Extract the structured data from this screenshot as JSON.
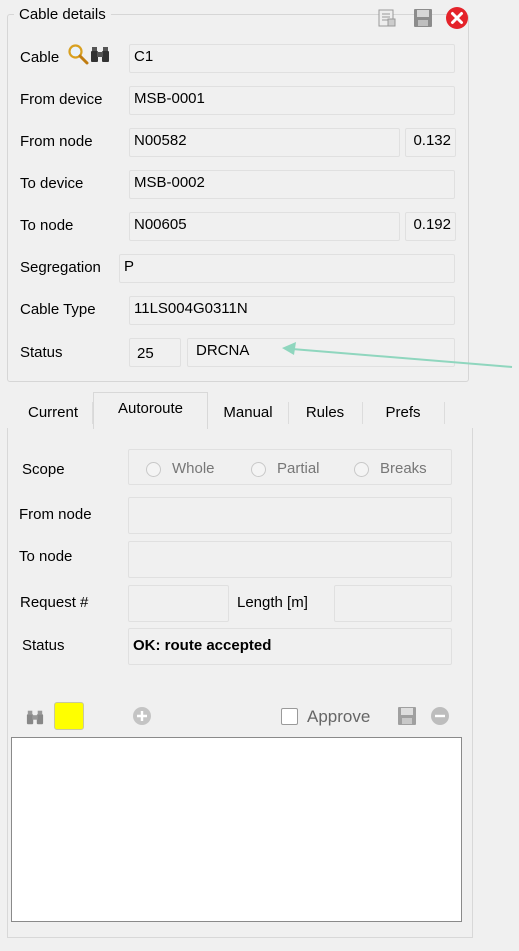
{
  "cable_details": {
    "title": "Cable details",
    "rows": {
      "cable": {
        "label": "Cable",
        "value": "C1"
      },
      "from_device": {
        "label": "From device",
        "value": "MSB-0001"
      },
      "from_node": {
        "label": "From node",
        "value": "N00582",
        "extra": "0.132"
      },
      "to_device": {
        "label": "To device",
        "value": "MSB-0002"
      },
      "to_node": {
        "label": "To node",
        "value": "N00605",
        "extra": "0.192"
      },
      "segregation": {
        "label": "Segregation",
        "value": "P"
      },
      "cable_type": {
        "label": "Cable Type",
        "value": "11LS004G0311N"
      },
      "status": {
        "label": "Status",
        "code": "25",
        "value": "DRCNA"
      }
    }
  },
  "tabs": [
    {
      "label": "Current"
    },
    {
      "label": "Autoroute"
    },
    {
      "label": "Manual"
    },
    {
      "label": "Rules"
    },
    {
      "label": "Prefs"
    }
  ],
  "active_tab": "Autoroute",
  "autoroute": {
    "scope_label": "Scope",
    "scope_options": [
      "Whole",
      "Partial",
      "Breaks"
    ],
    "from_node_label": "From node",
    "from_node_value": "",
    "to_node_label": "To node",
    "to_node_value": "",
    "request_label": "Request #",
    "request_value": "",
    "length_label": "Length [m]",
    "length_value": "",
    "status_label": "Status",
    "status_value": "OK: route accepted",
    "approve_label": "Approve"
  },
  "colors": {
    "close_red": "#e4232a",
    "yellow_swatch": "#ffff00",
    "arrow": "#8fd6be"
  },
  "icons": [
    "search-icon",
    "binoculars-icon",
    "report-icon",
    "save-icon",
    "close-icon",
    "add-icon",
    "remove-icon"
  ]
}
